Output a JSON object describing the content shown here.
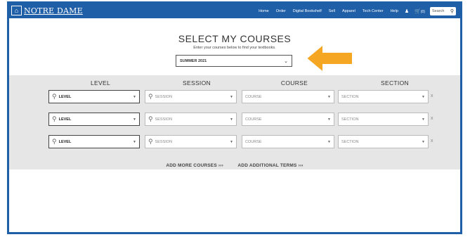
{
  "brand": {
    "logo_text": "NOTRE DAME"
  },
  "nav": {
    "items": [
      "Home",
      "Order",
      "Digital Bookshelf",
      "Sell",
      "Apparel",
      "Tech Center",
      "Help"
    ],
    "user_icon": "user-icon",
    "cart_label": "(0)",
    "search_placeholder": "Search"
  },
  "page": {
    "title": "SELECT MY COURSES",
    "subtitle": "Enter your courses below to find your textbooks.",
    "term_value": "SUMMER 2021"
  },
  "columns": {
    "level": "LEVEL",
    "session": "SESSION",
    "course": "COURSE",
    "section": "SECTION"
  },
  "rows": [
    {
      "level": "LEVEL",
      "session": "SESSION",
      "course": "COURSE",
      "section": "SECTION",
      "remove": "x"
    },
    {
      "level": "LEVEL",
      "session": "SESSION",
      "course": "COURSE",
      "section": "SECTION",
      "remove": "x"
    },
    {
      "level": "LEVEL",
      "session": "SESSION",
      "course": "COURSE",
      "section": "SECTION",
      "remove": "x"
    }
  ],
  "actions": {
    "add_courses": "ADD MORE COURSES ›››",
    "add_terms": "ADD ADDITIONAL TERMS ›››"
  },
  "colors": {
    "brand_blue": "#1f5fa8",
    "panel_gray": "#e6e6e6",
    "arrow_orange": "#f5a623"
  }
}
